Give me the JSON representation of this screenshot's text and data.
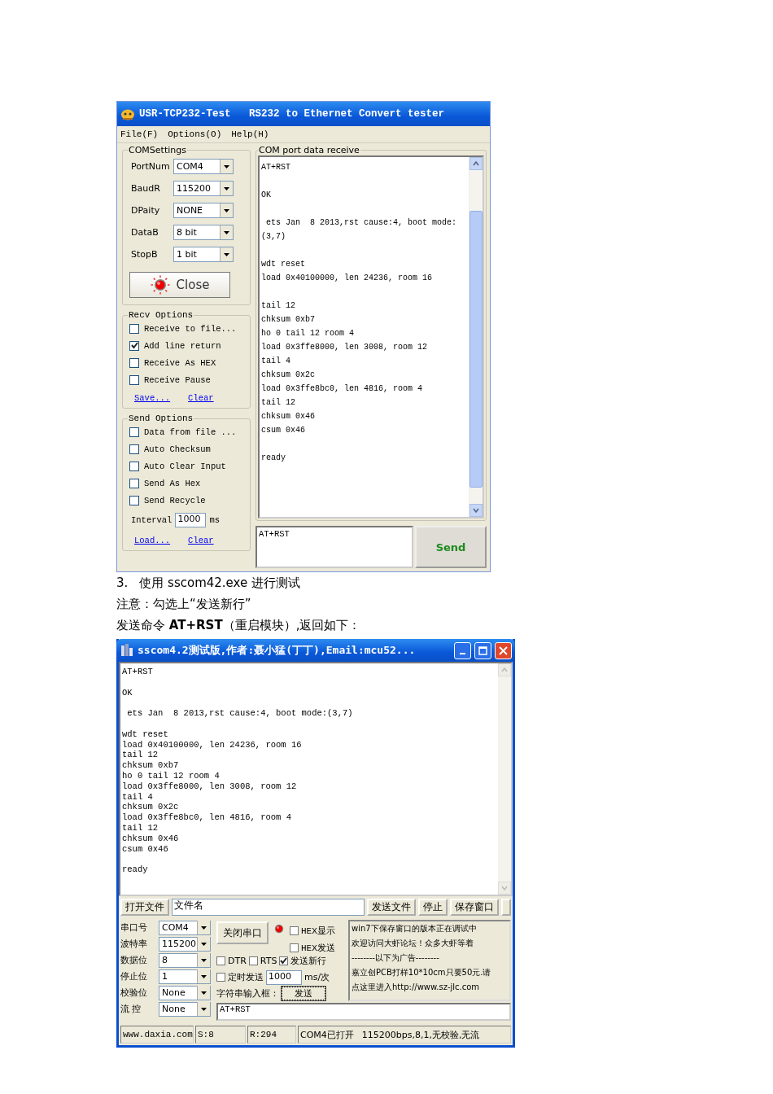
{
  "window_1": {
    "title": "USR-TCP232-Test   RS232 to Ethernet Convert tester",
    "menu": [
      "File(F)",
      "Options(O)",
      "Help(H)"
    ],
    "com_settings": {
      "legend": "COMSettings",
      "fields": [
        {
          "label": "PortNum",
          "value": "COM4"
        },
        {
          "label": "BaudR",
          "value": "115200"
        },
        {
          "label": "DPaity",
          "value": "NONE"
        },
        {
          "label": "DataB",
          "value": "8 bit"
        },
        {
          "label": "StopB",
          "value": "1 bit"
        }
      ],
      "close_button": "Close"
    },
    "recv_options": {
      "legend": "Recv Options",
      "checkboxes": [
        {
          "label": "Receive to file...",
          "checked": false
        },
        {
          "label": "Add line return",
          "checked": true
        },
        {
          "label": "Receive As HEX",
          "checked": false
        },
        {
          "label": "Receive Pause",
          "checked": false
        }
      ],
      "links": [
        "Save...",
        "Clear"
      ]
    },
    "send_options": {
      "legend": "Send Options",
      "checkboxes": [
        {
          "label": "Data from file ...",
          "checked": false
        },
        {
          "label": "Auto Checksum",
          "checked": false
        },
        {
          "label": "Auto Clear Input",
          "checked": false
        },
        {
          "label": "Send As Hex",
          "checked": false
        },
        {
          "label": "Send Recycle",
          "checked": false
        }
      ],
      "interval": {
        "label": "Interval",
        "value": "1000",
        "unit": "ms"
      },
      "links": [
        "Load...",
        "Clear"
      ]
    },
    "receive": {
      "legend": "COM port data receive",
      "blocks": [
        [
          "AT+RST"
        ],
        [
          "OK"
        ],
        [
          " ets Jan  8 2013,rst cause:4, boot mode:",
          "(3,7)"
        ],
        [
          "wdt reset",
          "load 0x40100000, len 24236, room 16"
        ],
        [
          "tail 12",
          "chksum 0xb7",
          "ho 0 tail 12 room 4",
          "load 0x3ffe8000, len 3008, room 12",
          "tail 4",
          "chksum 0x2c",
          "load 0x3ffe8bc0, len 4816, room 4",
          "tail 12",
          "chksum 0x46",
          "csum 0x46"
        ],
        [
          "ready"
        ]
      ]
    },
    "send_input": "AT+RST",
    "send_button": "Send"
  },
  "document": {
    "step_number": "3.",
    "step_text": "使用 sscom42.exe 进行测试",
    "note": "注意：勾选上“发送新行”",
    "instruction": "发送命令 **AT+RST**（重启模块）,返回如下："
  },
  "window_2": {
    "title": "sscom4.2测试版,作者:聂小猛(丁丁),Email:mcu52...",
    "log": [
      [
        "AT+RST"
      ],
      [
        "OK"
      ],
      [
        " ets Jan  8 2013,rst cause:4, boot mode:(3,7)"
      ],
      [
        "wdt reset",
        "load 0x40100000, len 24236, room 16",
        "tail 12",
        "chksum 0xb7",
        "ho 0 tail 12 room 4",
        "load 0x3ffe8000, len 3008, room 12",
        "tail 4",
        "chksum 0x2c",
        "load 0x3ffe8bc0, len 4816, room 4",
        "tail 12",
        "chksum 0x46",
        "csum 0x46"
      ],
      [
        "ready"
      ]
    ],
    "toolbar": {
      "open_file_button": "打开文件",
      "file_name": "文件名",
      "buttons": [
        "发送文件",
        "停止",
        "保存窗口"
      ]
    },
    "port_settings": [
      {
        "label": "串口号",
        "value": "COM4"
      },
      {
        "label": "波特率",
        "value": "115200"
      },
      {
        "label": "数据位",
        "value": "8"
      },
      {
        "label": "停止位",
        "value": "1"
      },
      {
        "label": "校验位",
        "value": "None"
      },
      {
        "label": "流 控",
        "value": "None"
      }
    ],
    "close_port_button": "关闭串口",
    "hex_display": {
      "label": "HEX显示",
      "checked": false
    },
    "hex_send": {
      "label": "HEX发送",
      "checked": false
    },
    "dtr": {
      "label": "DTR",
      "checked": false
    },
    "rts": {
      "label": "RTS",
      "checked": false
    },
    "send_newline": {
      "label": "发送新行",
      "checked": true
    },
    "timed_send": {
      "label": "定时发送",
      "checked": false,
      "value": "1000",
      "unit": "ms/次"
    },
    "string_input_label": "字符串输入框：",
    "send_button": "发送",
    "string_input": "AT+RST",
    "ad_lines": [
      "win7下保存窗口的版本正在调试中",
      "欢迎访问大虾论坛！众多大虾等着",
      "--------以下为广告--------",
      "嘉立创PCB打样10*10cm只要50元.请",
      "点这里进入http://www.sz-jlc.com"
    ],
    "status_bar": [
      "www.daxia.com",
      "S:8",
      "R:294",
      "COM4已打开",
      "115200bps,8,1,无校验,无流"
    ]
  }
}
